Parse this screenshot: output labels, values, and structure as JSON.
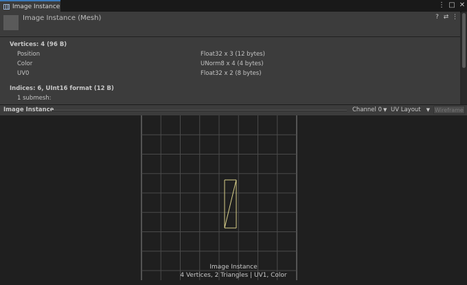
{
  "tab": {
    "title": "Image Instance",
    "icon": "mesh-grid-icon"
  },
  "window_controls": {
    "menu": "⋮",
    "maximize": "□",
    "close": "✕"
  },
  "header": {
    "title": "Image Instance (Mesh)",
    "help": "?",
    "settings": "⇄",
    "menu": "⋮"
  },
  "vertices": {
    "heading": "Vertices: 4 (96 B)",
    "attributes": [
      {
        "name": "Position",
        "format": "Float32 x 3 (12 bytes)"
      },
      {
        "name": "Color",
        "format": "UNorm8 x 4 (4 bytes)"
      },
      {
        "name": "UV0",
        "format": "Float32 x 2 (8 bytes)"
      }
    ]
  },
  "indices": {
    "heading": "Indices: 6, UInt16 format (12 B)",
    "submesh": "1 submesh:"
  },
  "preview_toolbar": {
    "title": "Image Instance",
    "channel": "Channel 0",
    "layout": "UV Layout",
    "wireframe": "Wireframe"
  },
  "preview": {
    "caption_name": "Image Instance",
    "caption_stats": "4 Vertices, 2 Triangles | UV1, Color",
    "grid_color": "#8a8a8a",
    "uv_color": "#d8cf8a"
  }
}
